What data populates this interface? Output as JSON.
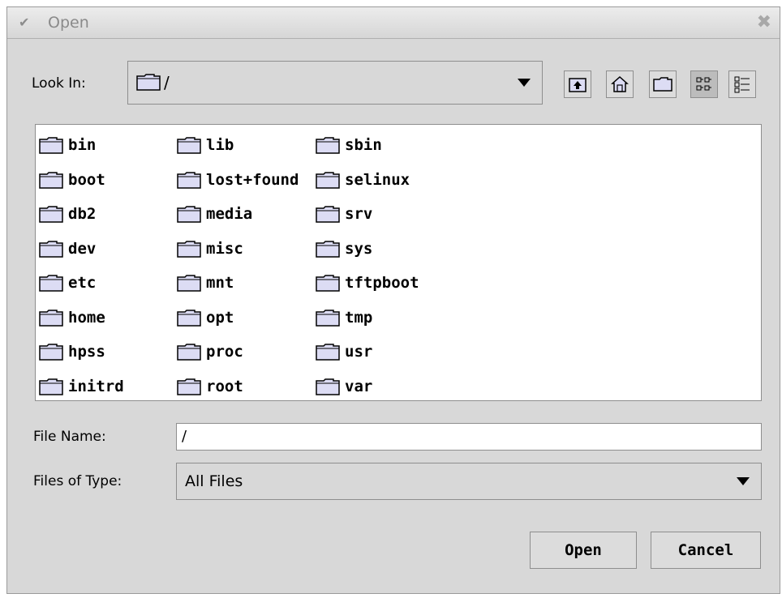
{
  "window": {
    "title": "Open"
  },
  "look_in": {
    "label": "Look In:",
    "value": "/"
  },
  "toolbar": {
    "buttons": [
      {
        "name": "up-folder-icon"
      },
      {
        "name": "home-icon"
      },
      {
        "name": "new-folder-icon"
      },
      {
        "name": "list-view-icon",
        "pressed": true
      },
      {
        "name": "details-view-icon"
      }
    ]
  },
  "files": {
    "columns": [
      [
        "bin",
        "boot",
        "db2",
        "dev",
        "etc",
        "home",
        "hpss",
        "initrd"
      ],
      [
        "lib",
        "lost+found",
        "media",
        "misc",
        "mnt",
        "opt",
        "proc",
        "root"
      ],
      [
        "sbin",
        "selinux",
        "srv",
        "sys",
        "tftpboot",
        "tmp",
        "usr",
        "var"
      ]
    ]
  },
  "file_name": {
    "label": "File Name:",
    "value": "/"
  },
  "file_type": {
    "label": "Files of Type:",
    "value": "All Files"
  },
  "buttons": {
    "open": "Open",
    "cancel": "Cancel"
  },
  "colors": {
    "dialog_bg": "#d8d8d8",
    "list_bg": "#ffffff",
    "folder_fill": "#dcdcf4"
  }
}
